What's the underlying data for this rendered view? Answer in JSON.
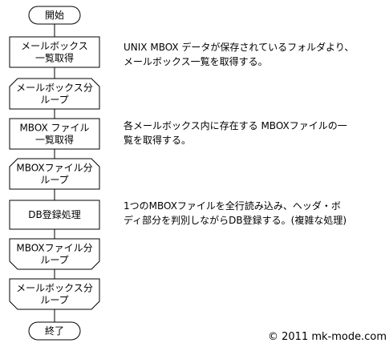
{
  "flowchart": {
    "nodes": [
      {
        "id": "start",
        "shape": "terminal",
        "lines": [
          "開始"
        ]
      },
      {
        "id": "get_mailboxes",
        "shape": "process",
        "lines": [
          "メールボックス",
          "一覧取得"
        ]
      },
      {
        "id": "mailbox_loop_start",
        "shape": "loop-start",
        "lines": [
          "メールボックス分",
          "ループ"
        ]
      },
      {
        "id": "get_mbox_files",
        "shape": "process",
        "lines": [
          "MBOX ファイル",
          "一覧取得"
        ]
      },
      {
        "id": "mbox_loop_start",
        "shape": "loop-start",
        "lines": [
          "MBOXファイル分",
          "ループ"
        ]
      },
      {
        "id": "db_register",
        "shape": "process",
        "lines": [
          "DB登録処理"
        ]
      },
      {
        "id": "mbox_loop_end",
        "shape": "loop-end",
        "lines": [
          "MBOXファイル分",
          "ループ"
        ]
      },
      {
        "id": "mailbox_loop_end",
        "shape": "loop-end",
        "lines": [
          "メールボックス分",
          "ループ"
        ]
      },
      {
        "id": "end",
        "shape": "terminal",
        "lines": [
          "終了"
        ]
      }
    ],
    "edges": [
      [
        "start",
        "get_mailboxes"
      ],
      [
        "get_mailboxes",
        "mailbox_loop_start"
      ],
      [
        "mailbox_loop_start",
        "get_mbox_files"
      ],
      [
        "get_mbox_files",
        "mbox_loop_start"
      ],
      [
        "mbox_loop_start",
        "db_register"
      ],
      [
        "db_register",
        "mbox_loop_end"
      ],
      [
        "mbox_loop_end",
        "mailbox_loop_end"
      ],
      [
        "mailbox_loop_end",
        "end"
      ]
    ]
  },
  "notes": {
    "note1": "UNIX MBOX データが保存されているフォルダより、\nメールボックス一覧を取得する。",
    "note2": "各メールボックス内に存在する MBOXファイルの一\n覧を取得する。",
    "note3": "1つのMBOXファイルを全行読み込み、ヘッダ・ボ\nディ部分を判別しながらDB登録する。(複雑な処理)"
  },
  "copyright": "© 2011 mk-mode.com"
}
